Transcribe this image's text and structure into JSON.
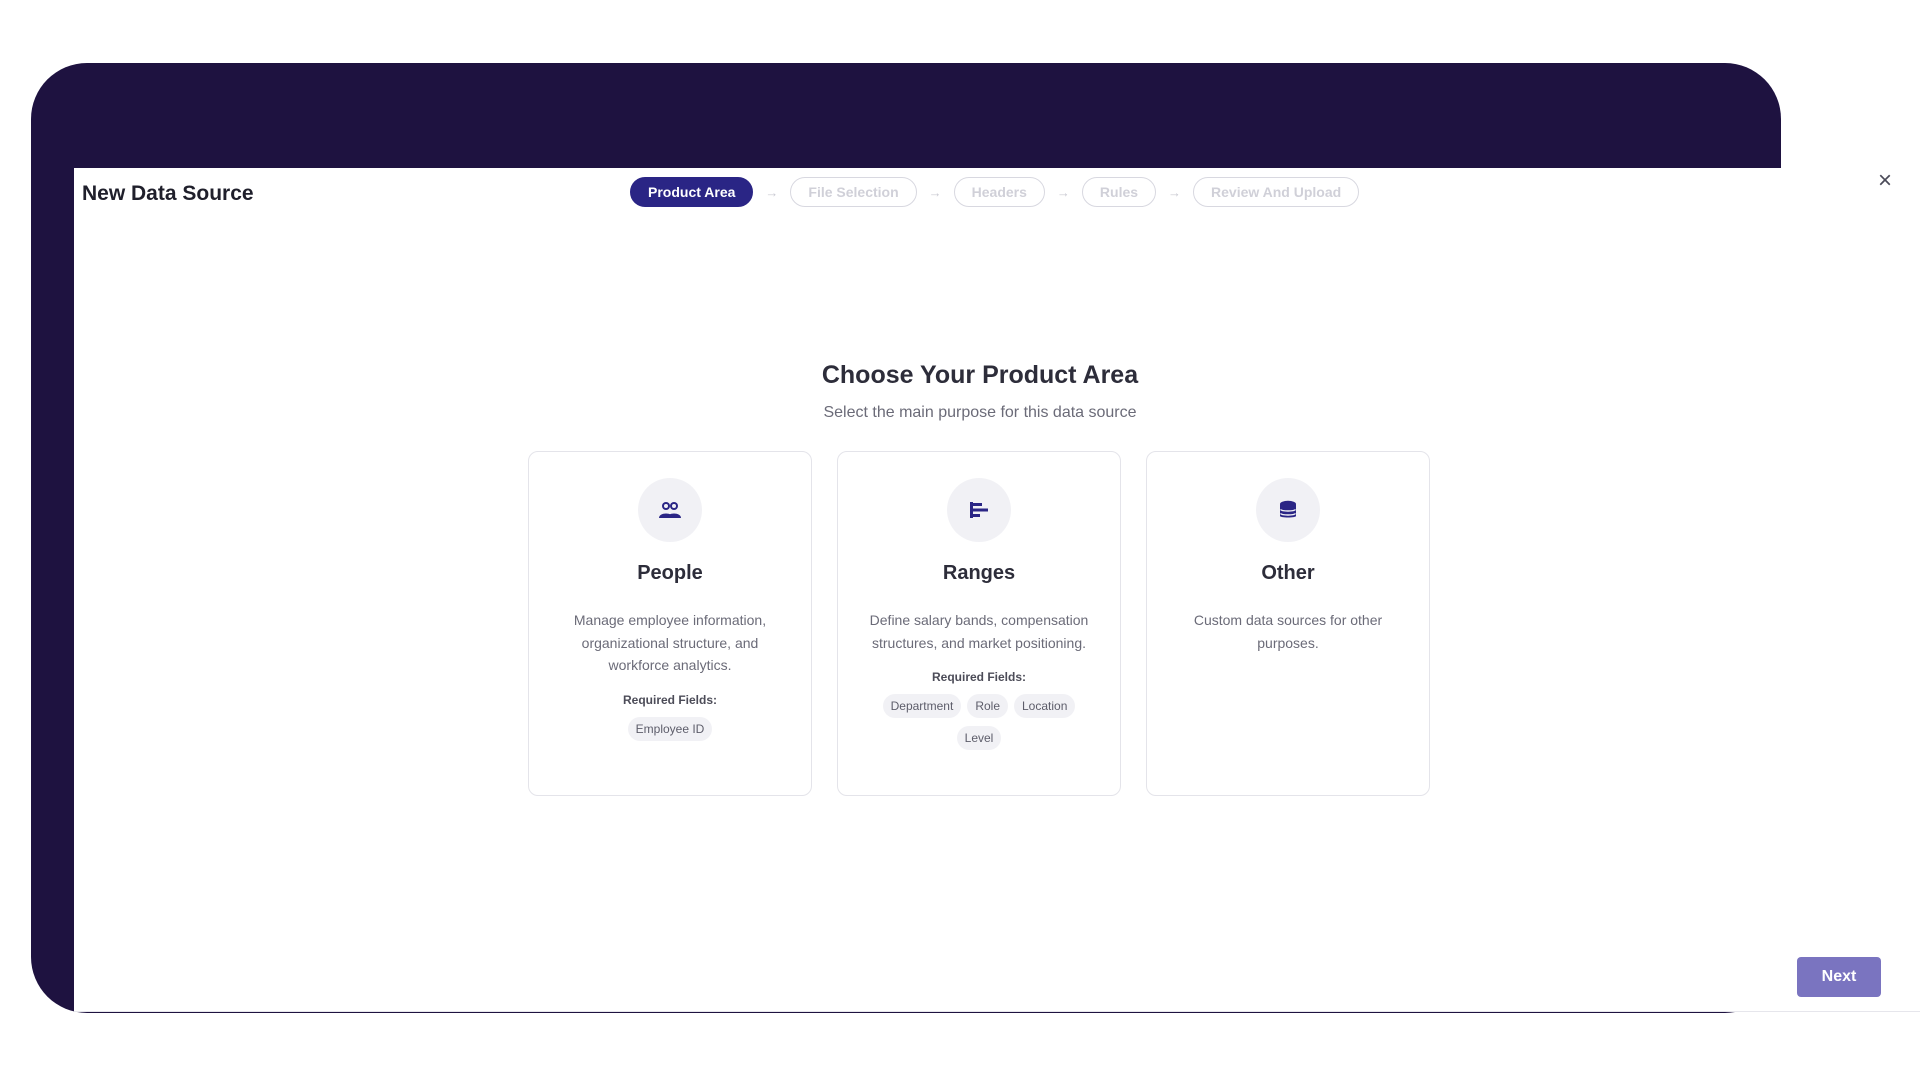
{
  "modal": {
    "title": "New Data Source",
    "close_label": "×"
  },
  "stepper": {
    "steps": [
      {
        "label": "Product Area",
        "active": true
      },
      {
        "label": "File Selection",
        "active": false
      },
      {
        "label": "Headers",
        "active": false
      },
      {
        "label": "Rules",
        "active": false
      },
      {
        "label": "Review And Upload",
        "active": false
      }
    ],
    "separator": "→"
  },
  "main": {
    "heading": "Choose Your Product Area",
    "subheading": "Select the main purpose for this data source"
  },
  "cards": [
    {
      "icon": "people-icon",
      "title": "People",
      "description": "Manage employee information, organizational structure, and workforce analytics.",
      "required_label": "Required Fields:",
      "fields": [
        "Employee ID"
      ]
    },
    {
      "icon": "ranges-icon",
      "title": "Ranges",
      "description": "Define salary bands, compensation structures, and market positioning.",
      "required_label": "Required Fields:",
      "fields": [
        "Department",
        "Role",
        "Location",
        "Level"
      ]
    },
    {
      "icon": "database-icon",
      "title": "Other",
      "description": "Custom data sources for other purposes.",
      "required_label": "",
      "fields": []
    }
  ],
  "footer": {
    "next_label": "Next"
  },
  "colors": {
    "brand_dark": "#1e1240",
    "active_step": "#2a2585",
    "next_button": "#7a74c0"
  }
}
